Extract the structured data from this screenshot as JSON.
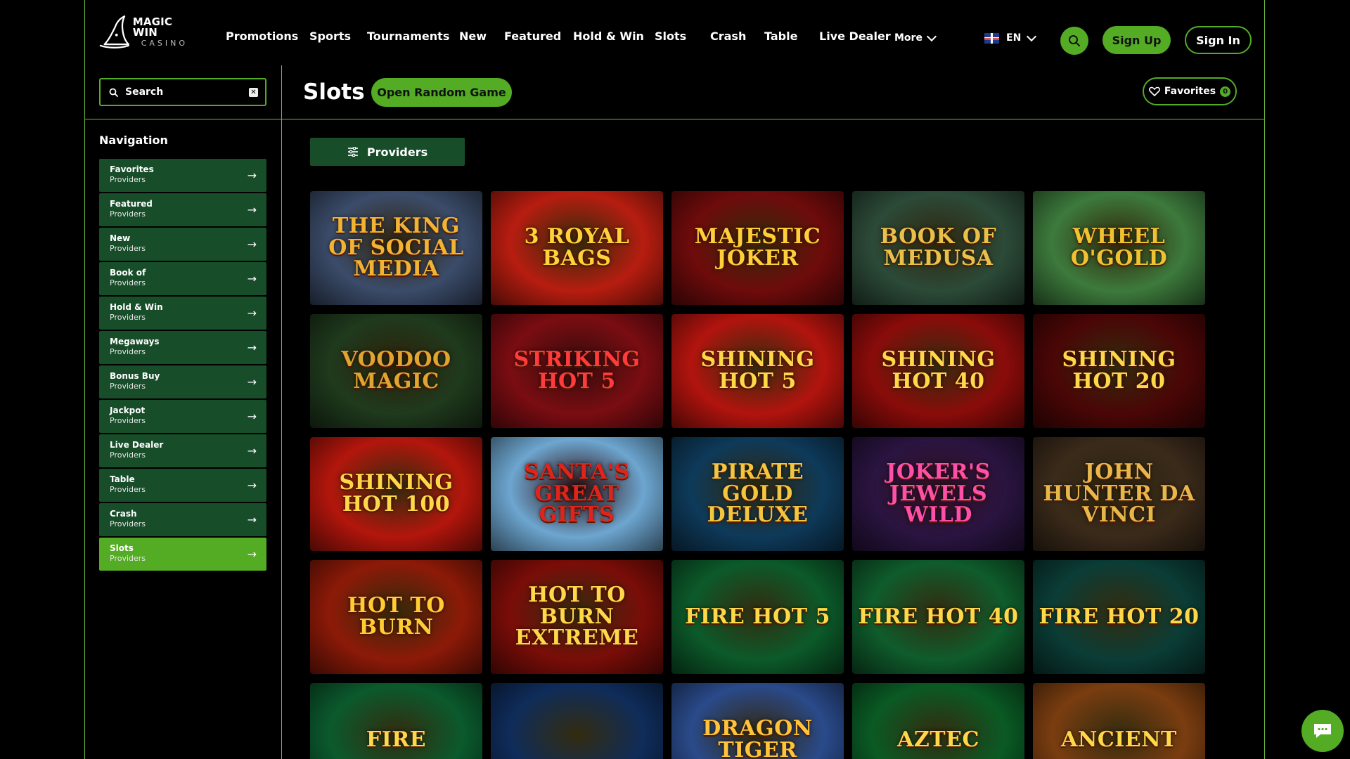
{
  "brand": {
    "name": "MAGIC WIN",
    "subname": "CASINO"
  },
  "nav": {
    "items": [
      "Promotions",
      "Sports",
      "Tournaments",
      "New",
      "Featured",
      "Hold & Win",
      "Slots",
      "Crash",
      "Table",
      "Live Dealer"
    ],
    "more_label": "More"
  },
  "language": {
    "code": "EN",
    "flag": "uk-flag-icon"
  },
  "auth": {
    "signup": "Sign Up",
    "signin": "Sign In"
  },
  "sidebar": {
    "search_placeholder": "Search",
    "heading": "Navigation",
    "items": [
      {
        "title": "Favorites",
        "sub": "Providers",
        "active": false
      },
      {
        "title": "Featured",
        "sub": "Providers",
        "active": false
      },
      {
        "title": "New",
        "sub": "Providers",
        "active": false
      },
      {
        "title": "Book of",
        "sub": "Providers",
        "active": false
      },
      {
        "title": "Hold & Win",
        "sub": "Providers",
        "active": false
      },
      {
        "title": "Megaways",
        "sub": "Providers",
        "active": false
      },
      {
        "title": "Bonus Buy",
        "sub": "Providers",
        "active": false
      },
      {
        "title": "Jackpot",
        "sub": "Providers",
        "active": false
      },
      {
        "title": "Live Dealer",
        "sub": "Providers",
        "active": false
      },
      {
        "title": "Table",
        "sub": "Providers",
        "active": false
      },
      {
        "title": "Crash",
        "sub": "Providers",
        "active": false
      },
      {
        "title": "Slots",
        "sub": "Providers",
        "active": true
      }
    ]
  },
  "main": {
    "title": "Slots",
    "random_button": "Open Random Game",
    "favorites_label": "Favorites",
    "favorites_count": "0",
    "providers_button": "Providers"
  },
  "games": [
    {
      "title": "THE KING OF SOCIAL MEDIA",
      "bg": "#3b4c6a",
      "accent": "#f2b233"
    },
    {
      "title": "3 ROYAL BAGS",
      "bg": "#b71d10",
      "accent": "#ffd23a"
    },
    {
      "title": "MAJESTIC JOKER",
      "bg": "#6e0b0b",
      "accent": "#ffcf3a"
    },
    {
      "title": "BOOK OF MEDUSA",
      "bg": "#2c4a38",
      "accent": "#e8c04a"
    },
    {
      "title": "WHEEL O'GOLD",
      "bg": "#3d7a3c",
      "accent": "#f0c232"
    },
    {
      "title": "VOODOO MAGIC",
      "bg": "#1f3a1d",
      "accent": "#e0a431"
    },
    {
      "title": "STRIKING HOT 5",
      "bg": "#7a0d12",
      "accent": "#ff3b3b"
    },
    {
      "title": "SHINING HOT 5",
      "bg": "#b2140e",
      "accent": "#ffd84a"
    },
    {
      "title": "SHINING HOT 40",
      "bg": "#8a0c0a",
      "accent": "#ffd84a"
    },
    {
      "title": "SHINING HOT 20",
      "bg": "#4a0606",
      "accent": "#ffd84a"
    },
    {
      "title": "SHINING HOT 100",
      "bg": "#b3160c",
      "accent": "#ffd84a"
    },
    {
      "title": "SANTA'S GREAT GIFTS",
      "bg": "#6da6d0",
      "accent": "#e0241c"
    },
    {
      "title": "PIRATE GOLD DELUXE",
      "bg": "#0e3a5a",
      "accent": "#f3c63d"
    },
    {
      "title": "JOKER'S JEWELS WILD",
      "bg": "#2a1440",
      "accent": "#ff4fa8"
    },
    {
      "title": "JOHN HUNTER DA VINCI",
      "bg": "#3a2a1a",
      "accent": "#e8b74a"
    },
    {
      "title": "HOT TO BURN",
      "bg": "#8d1a08",
      "accent": "#ffcc33"
    },
    {
      "title": "HOT TO BURN EXTREME",
      "bg": "#7a0d08",
      "accent": "#ffd84a"
    },
    {
      "title": "FIRE HOT 5",
      "bg": "#0c5a2a",
      "accent": "#ffd84a"
    },
    {
      "title": "FIRE HOT 40",
      "bg": "#0f5c2c",
      "accent": "#ffd84a"
    },
    {
      "title": "FIRE HOT 20",
      "bg": "#0b3d36",
      "accent": "#ffd84a"
    },
    {
      "title": "FIRE",
      "bg": "#0b5a2d",
      "accent": "#ffd84a"
    },
    {
      "title": "",
      "bg": "#0f2c5a",
      "accent": "#ffd84a"
    },
    {
      "title": "DRAGON TIGER",
      "bg": "#2a4a8a",
      "accent": "#ffc43a"
    },
    {
      "title": "AZTEC",
      "bg": "#0a5a24",
      "accent": "#ffd84a"
    },
    {
      "title": "ANCIENT",
      "bg": "#7a3d10",
      "accent": "#ffd84a"
    }
  ],
  "colors": {
    "accent": "#54ac25",
    "dark_green": "#184d2a",
    "border": "#6fbf3d",
    "background": "#000000"
  }
}
